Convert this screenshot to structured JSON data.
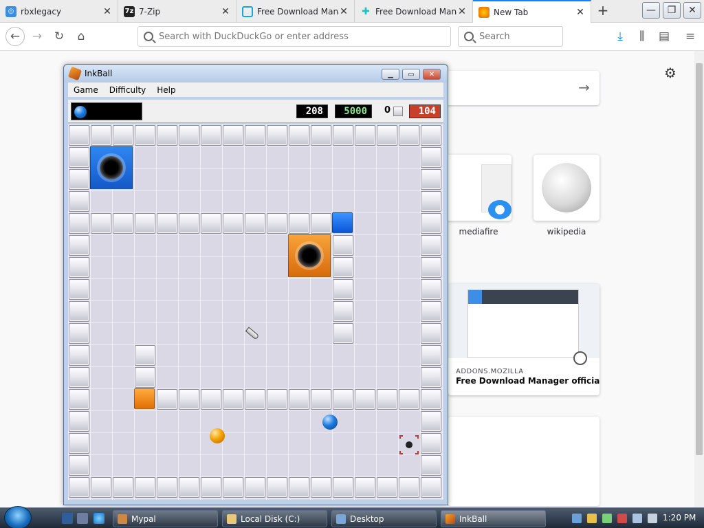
{
  "browser": {
    "tabs": [
      {
        "label": "rbxlegacy",
        "fav": "rbx-icon",
        "favColor": "#3b8de0"
      },
      {
        "label": "7-Zip",
        "fav": "7zip-icon",
        "favColor": "#222222"
      },
      {
        "label": "Free Download Mana",
        "fav": "fdm-icon",
        "favColor": "#1aa4d8"
      },
      {
        "label": "Free Download Mana",
        "fav": "puzzle-icon",
        "favColor": "#1fc2c2"
      },
      {
        "label": "New Tab",
        "fav": "firefox-icon",
        "favColor": "#e66000"
      }
    ],
    "url_placeholder": "Search with DuckDuckGo or enter address",
    "search_placeholder": "Search"
  },
  "newtab": {
    "sites": [
      {
        "label": "mediafire"
      },
      {
        "label": "wikipedia"
      }
    ],
    "card": {
      "source": "ADDONS.MOZILLA",
      "title": "Free Download Manager official ..."
    }
  },
  "inkball": {
    "title": "InkBall",
    "menu": [
      "Game",
      "Difficulty",
      "Help"
    ],
    "time": "208",
    "score": "5000",
    "count": "0",
    "penalty": "104",
    "colors": {
      "blue": "#1e7be0",
      "orange": "#f5a300",
      "time_fg": "#ffffff",
      "score_fg": "#8ee68e",
      "penalty_bg": "#c8402b"
    }
  },
  "taskbar": {
    "tasks": [
      {
        "label": "Mypal",
        "icon": "mypal-icon"
      },
      {
        "label": "Local Disk (C:)",
        "icon": "folder-icon"
      },
      {
        "label": "Desktop",
        "icon": "desktop-icon"
      },
      {
        "label": "InkBall",
        "icon": "inkball-icon"
      }
    ],
    "clock": "1:20 PM"
  }
}
